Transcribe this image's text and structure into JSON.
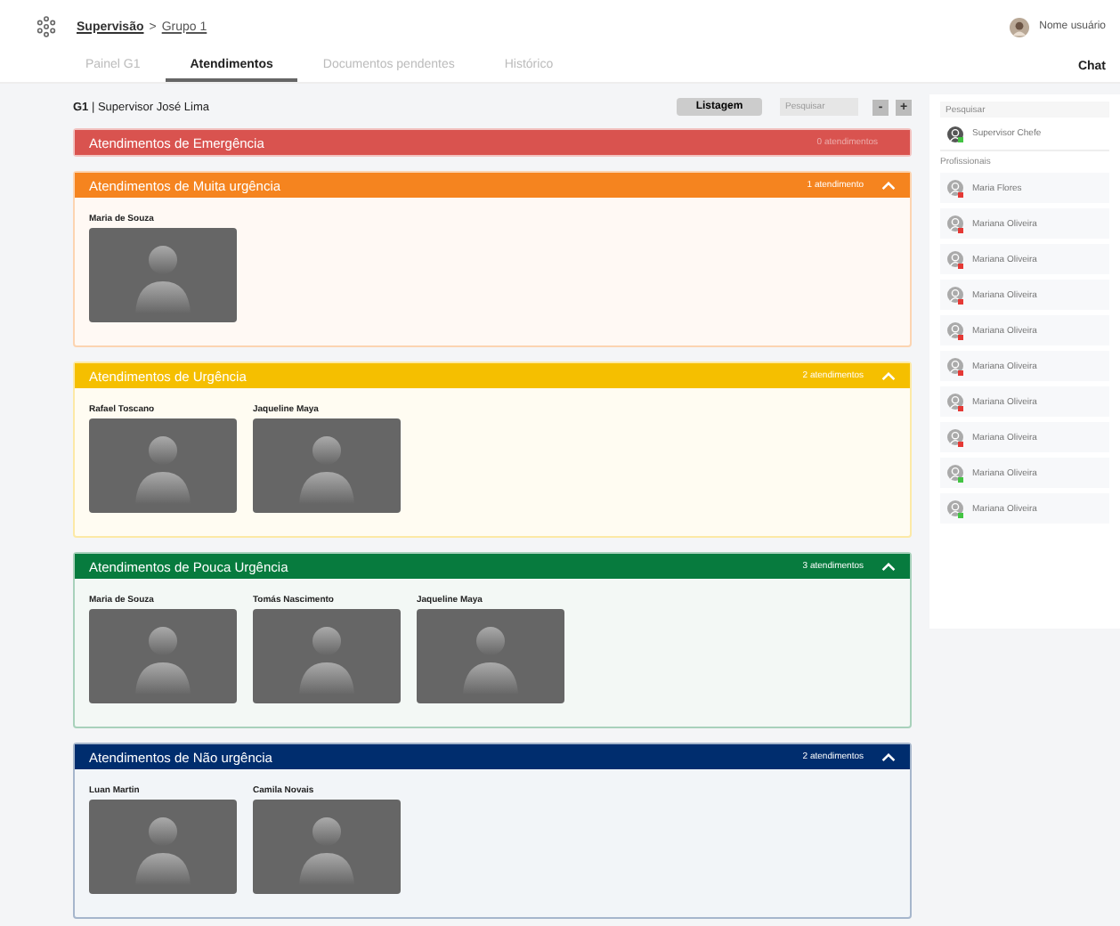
{
  "header": {
    "breadcrumb_root": "Supervisão",
    "breadcrumb_separator": ">",
    "breadcrumb_current": "Grupo 1",
    "user_name": "Nome usuário"
  },
  "tabs": [
    {
      "label": "Painel G1",
      "selected": false
    },
    {
      "label": "Atendimentos",
      "selected": true
    },
    {
      "label": "Documentos pendentes",
      "selected": false
    },
    {
      "label": "Histórico",
      "selected": false
    }
  ],
  "chat_title": "Chat",
  "toolbar": {
    "group": "G1",
    "separator": "|",
    "supervisor": "Supervisor José Lima",
    "list_button": "Listagem",
    "search": {
      "placeholder": "Pesquisar"
    },
    "minus": "-",
    "plus": "+"
  },
  "sections": [
    {
      "title": "Atendimentos de Emergência",
      "count": "0 atendimentos",
      "color": "#d9534f",
      "expanded": false
    },
    {
      "title": "Atendimentos de Muita urgência",
      "count": "1 atendimento",
      "color": "#f5841f",
      "expanded": true,
      "people": [
        "Maria de Souza"
      ]
    },
    {
      "title": "Atendimentos de Urgência",
      "count": "2 atendimentos",
      "color": "#f5bf00",
      "expanded": true,
      "people": [
        "Rafael Toscano",
        "Jaqueline Maya"
      ]
    },
    {
      "title": "Atendimentos de Pouca Urgência",
      "count": "3 atendimentos",
      "color": "#077b3e",
      "expanded": true,
      "people": [
        "Maria de Souza",
        "Tomás Nascimento",
        "Jaqueline Maya"
      ]
    },
    {
      "title": "Atendimentos de Não urgência",
      "count": "2 atendimentos",
      "color": "#002d6e",
      "expanded": true,
      "people": [
        "Luan Martin",
        "Camila Novais"
      ]
    }
  ],
  "chat": {
    "search": {
      "placeholder": "Pesquisar"
    },
    "chief": {
      "name": "Supervisor Chefe",
      "color": "#43c443"
    },
    "professionals_label": "Profissionais",
    "professionals": [
      {
        "name": "Maria Flores",
        "color": "#e53935"
      },
      {
        "name": "Mariana Oliveira",
        "color": "#e53935"
      },
      {
        "name": "Mariana Oliveira",
        "color": "#e53935"
      },
      {
        "name": "Mariana Oliveira",
        "color": "#e53935"
      },
      {
        "name": "Mariana Oliveira",
        "color": "#e53935"
      },
      {
        "name": "Mariana Oliveira",
        "color": "#e53935"
      },
      {
        "name": "Mariana Oliveira",
        "color": "#e53935"
      },
      {
        "name": "Mariana Oliveira",
        "color": "#e53935"
      },
      {
        "name": "Mariana Oliveira",
        "color": "#43c443"
      },
      {
        "name": "Mariana Oliveira",
        "color": "#43c443"
      }
    ]
  }
}
